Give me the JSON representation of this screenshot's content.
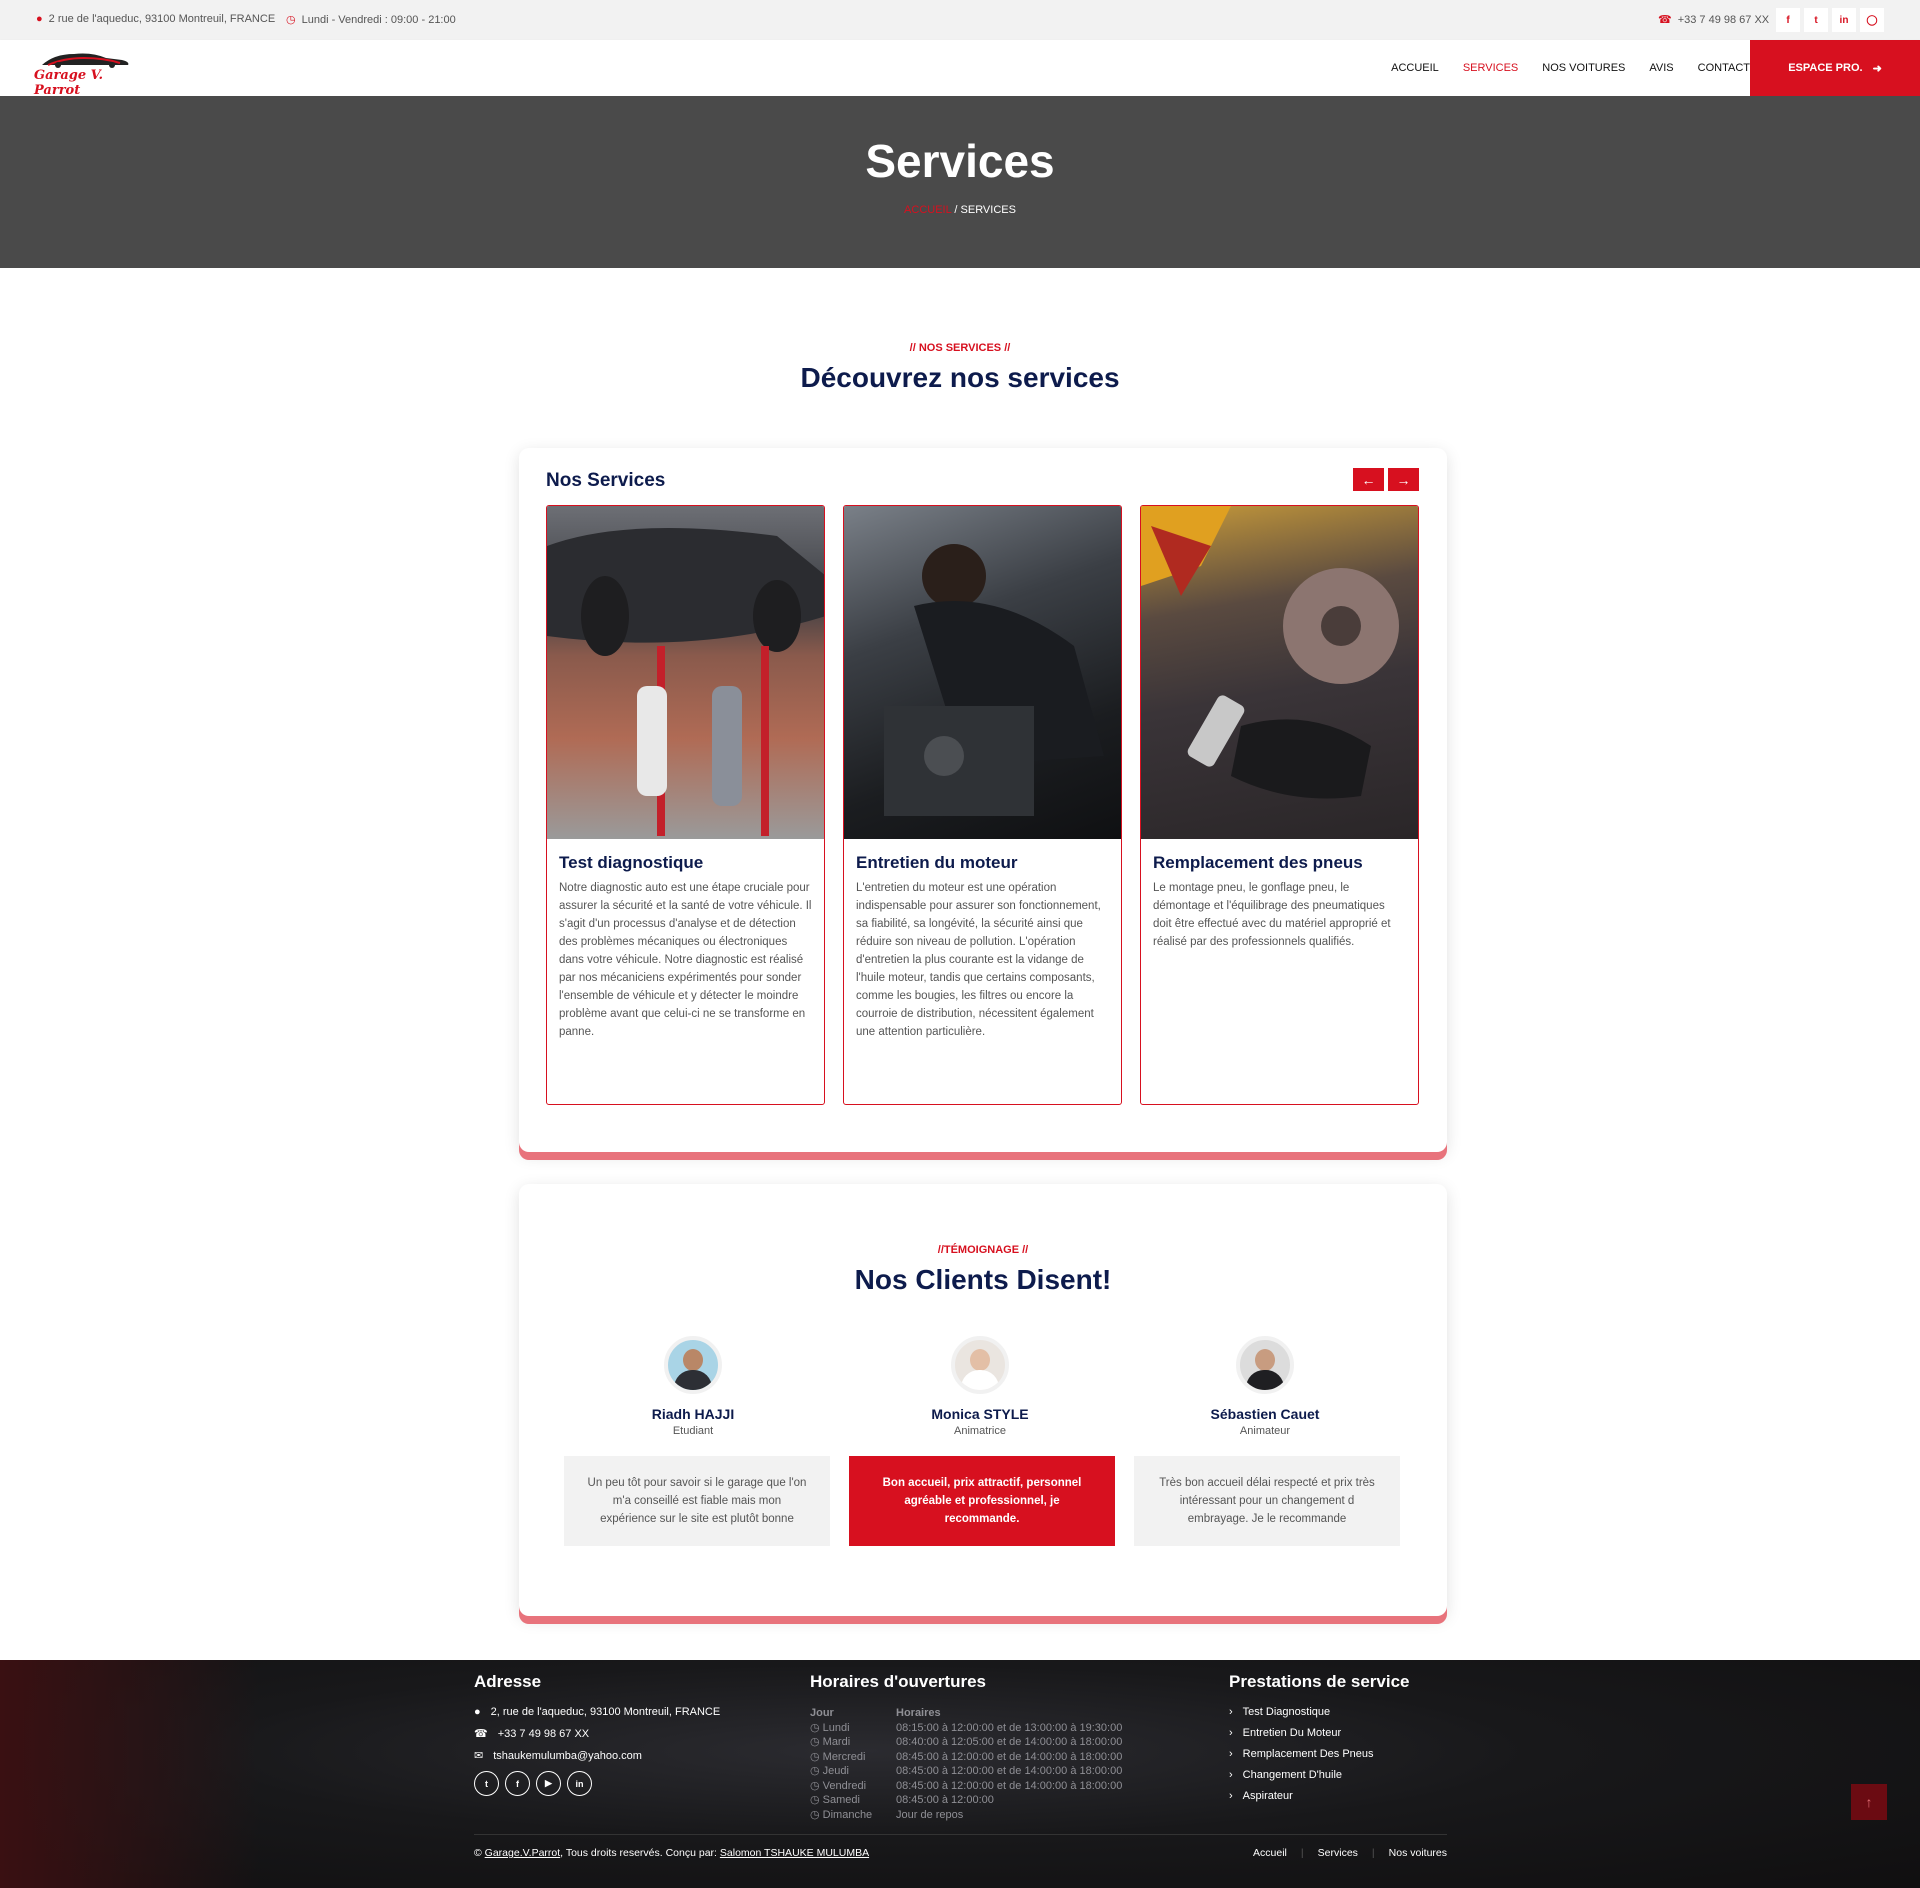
{
  "topbar": {
    "address": "2 rue de l'aqueduc, 93100 Montreuil, FRANCE",
    "hours": "Lundi - Vendredi : 09:00 - 21:00",
    "phone": "+33 7 49 98 67 XX",
    "socials": [
      "facebook-icon",
      "twitter-icon",
      "linkedin-icon",
      "instagram-icon"
    ]
  },
  "nav": {
    "logo_text": "Garage V. Parrot",
    "items": [
      "ACCUEIL",
      "SERVICES",
      "NOS VOITURES",
      "AVIS",
      "CONTACT"
    ],
    "active": "SERVICES",
    "cta": "ESPACE PRO."
  },
  "hero": {
    "title": "Services",
    "breadcrumb_home": "ACCUEIL",
    "breadcrumb_sep": "/",
    "breadcrumb_current": "SERVICES"
  },
  "services_section": {
    "eyebrow": "// NOS SERVICES //",
    "title": "Découvrez nos services",
    "panel_title": "Nos Services",
    "cards": [
      {
        "title": "Test diagnostique",
        "text": "Notre diagnostic auto est une étape cruciale pour assurer la sécurité et la santé de votre véhicule. Il s'agit d'un processus d'analyse et de détection des problèmes mécaniques ou électroniques dans votre véhicule. Notre diagnostic est réalisé par nos mécaniciens expérimentés pour sonder l'ensemble de véhicule et y détecter le moindre problème avant que celui-ci ne se transforme en panne."
      },
      {
        "title": "Entretien du moteur",
        "text": "L'entretien du moteur est une opération indispensable pour assurer son fonctionnement, sa fiabilité, sa longévité, la sécurité ainsi que réduire son niveau de pollution. L'opération d'entretien la plus courante est la vidange de l'huile moteur, tandis que certains composants, comme les bougies, les filtres ou encore la courroie de distribution, nécessitent également une attention particulière."
      },
      {
        "title": "Remplacement des pneus",
        "text": "Le montage pneu, le gonflage pneu, le démontage et l'équilibrage des pneumatiques doit être effectué avec du matériel approprié et réalisé par des professionnels qualifiés."
      }
    ]
  },
  "testimonials": {
    "eyebrow": "//TÉMOIGNAGE //",
    "title": "Nos Clients Disent!",
    "people": [
      {
        "name": "Riadh HAJJI",
        "role": "Etudiant",
        "quote": "Un peu tôt pour savoir si le garage que l'on m'a conseillé est fiable mais mon expérience sur le site est plutôt bonne"
      },
      {
        "name": "Monica STYLE",
        "role": "Animatrice",
        "quote": "Bon accueil, prix attractif, personnel agréable et professionnel, je recommande."
      },
      {
        "name": "Sébastien Cauet",
        "role": "Animateur",
        "quote": "Très bon accueil délai respecté et prix très intéressant pour un changement d embrayage. Je le recommande"
      }
    ]
  },
  "footer": {
    "address_title": "Adresse",
    "address": "2, rue de l'aqueduc, 93100 Montreuil, FRANCE",
    "phone": "+33 7 49 98 67 XX",
    "email": "tshaukemulumba@yahoo.com",
    "hours_title": "Horaires d'ouvertures",
    "hours_col1": "Jour",
    "hours_col2": "Horaires",
    "hours": [
      {
        "day": "Lundi",
        "time": "08:15:00 à 12:00:00 et de 13:00:00 à 19:30:00"
      },
      {
        "day": "Mardi",
        "time": "08:40:00 à 12:05:00 et de 14:00:00 à 18:00:00"
      },
      {
        "day": "Mercredi",
        "time": "08:45:00 à 12:00:00 et de 14:00:00 à 18:00:00"
      },
      {
        "day": "Jeudi",
        "time": "08:45:00 à 12:00:00 et de 14:00:00 à 18:00:00"
      },
      {
        "day": "Vendredi",
        "time": "08:45:00 à 12:00:00 et de 14:00:00 à 18:00:00"
      },
      {
        "day": "Samedi",
        "time": "08:45:00 à 12:00:00"
      },
      {
        "day": "Dimanche",
        "time": "Jour de repos"
      }
    ],
    "services_title": "Prestations de service",
    "services": [
      "Test Diagnostique",
      "Entretien Du Moteur",
      "Remplacement Des Pneus",
      "Changement D'huile",
      "Aspirateur"
    ],
    "copyright_prefix": "©",
    "copyright_brand": "Garage.V.Parrot",
    "copyright_mid": ", Tous droits reservés. Conçu par:",
    "copyright_author": "Salomon TSHAUKE MULUMBA",
    "links": [
      "Accueil",
      "Services",
      "Nos voitures"
    ]
  },
  "colors": {
    "accent": "#d7101f",
    "navy": "#0d1b4c",
    "hero_bg": "#4a4a4a"
  }
}
